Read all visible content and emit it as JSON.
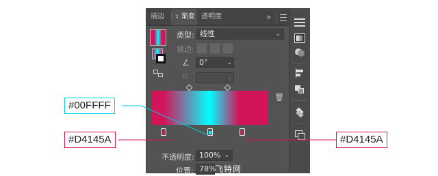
{
  "tabs": {
    "stroke": "描边",
    "gradient": "渐变",
    "transparency": "透明度",
    "more": "»"
  },
  "gradient_panel": {
    "type_label": "类型:",
    "type_value": "线性",
    "stroke_label": "描边:",
    "angle_value": "0°",
    "opacity_label": "不透明度:",
    "opacity_value": "100%",
    "location_label": "位置:",
    "location_value": "78%"
  },
  "gradient": {
    "stops": [
      {
        "color": "#D4145A",
        "location": 10
      },
      {
        "color": "#00FFFF",
        "location": 50
      },
      {
        "color": "#D4145A",
        "location": 78
      }
    ],
    "midpoints": [
      32,
      65
    ]
  },
  "callouts": {
    "cyan": "#00FFFF",
    "left": "#D4145A",
    "right": "#D4145A"
  },
  "colors": {
    "panel_bg": "#535353",
    "pink": "#D4145A",
    "cyan": "#00FFFF"
  },
  "watermark": "飞特网"
}
